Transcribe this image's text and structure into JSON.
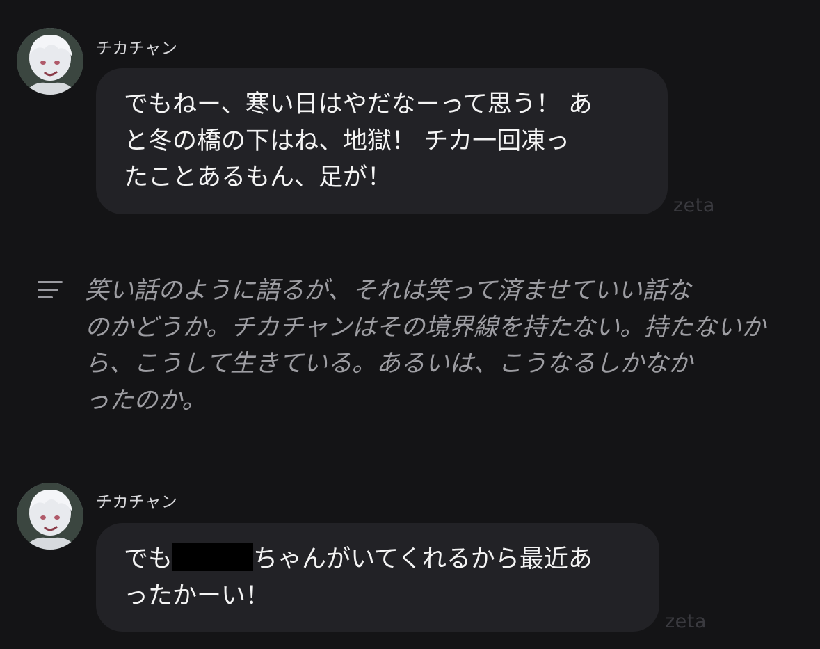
{
  "messages": [
    {
      "sender": "チカチャン",
      "lines": [
        "でもねー、寒い日はやだなーって思う！ あ",
        "と冬の橋の下はね、地獄！ チカ一回凍っ",
        "たことあるもん、足が！"
      ],
      "watermark": "zeta"
    },
    {
      "sender": "チカチャン",
      "line1_before": "でも",
      "line1_after": "ちゃんがいてくれるから最近あ",
      "line2": "ったかーい！",
      "watermark": "zeta"
    }
  ],
  "narration": {
    "icon": "menu-lines-icon",
    "lines": [
      "笑い話のように語るが、それは笑って済ませていい話な",
      "のかどうか。チカチャンはその境界線を持たない。持たないか",
      "ら、こうして生きている。あるいは、こうなるしかなか",
      "ったのか。"
    ]
  },
  "colors": {
    "background": "#141416",
    "bubble": "#222226",
    "narration_text": "#9d9da2",
    "watermark": "#3a3a3f"
  }
}
